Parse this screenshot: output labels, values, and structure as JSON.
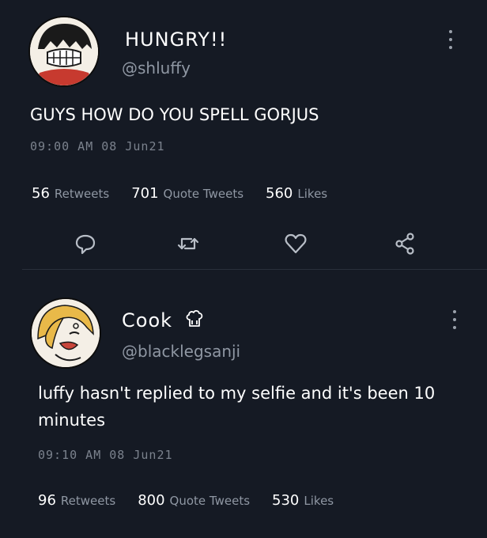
{
  "tweets": [
    {
      "display_name": "HUNGRY!!",
      "handle": "@shluffy",
      "text": "GUYS HOW DO YOU SPELL GORJUS",
      "timestamp": "09:00 AM  08 Jun21",
      "stats": {
        "retweets": {
          "count": "56",
          "label": "Retweets"
        },
        "quotes": {
          "count": "701",
          "label": "Quote Tweets"
        },
        "likes": {
          "count": "560",
          "label": "Likes"
        }
      }
    },
    {
      "display_name": "Cook",
      "handle": "@blacklegsanji",
      "text": "luffy hasn't replied to my selfie and it's been 10 minutes",
      "timestamp": "09:10 AM  08 Jun21",
      "stats": {
        "retweets": {
          "count": "96",
          "label": "Retweets"
        },
        "quotes": {
          "count": "800",
          "label": "Quote Tweets"
        },
        "likes": {
          "count": "530",
          "label": "Likes"
        }
      }
    }
  ],
  "icons": [
    "reply-icon",
    "retweet-icon",
    "like-icon",
    "share-icon",
    "more-options-icon",
    "chef-hat-icon"
  ],
  "colors": {
    "background": "#151a24",
    "text": "#ffffff",
    "muted": "#8f97a3",
    "divider": "#2a303b"
  }
}
